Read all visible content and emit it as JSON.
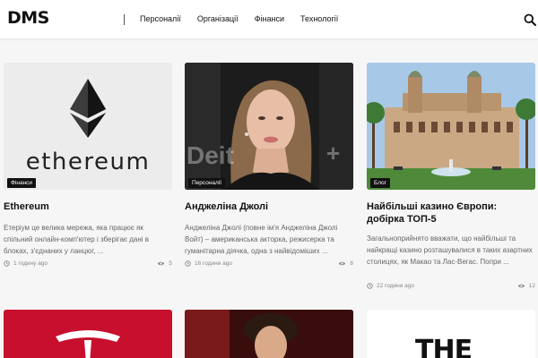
{
  "header": {
    "logo": "DMS",
    "nav": [
      "Персоналії",
      "Організації",
      "Фінанси",
      "Технології"
    ]
  },
  "cards": [
    {
      "badge": "Фінанси",
      "image_text": "ethereum",
      "title": "Ethereum",
      "excerpt": "Етеріум це велика мережа, яка працює як спільний онлайн-комп'ютер і зберігає дані в блоках, з'єднаних у ланцюг, ...",
      "time": "1 годину ago",
      "views": "5"
    },
    {
      "badge": "Персоналії",
      "image_text": "Deit",
      "title": "Анджеліна Джолі",
      "excerpt": "Анджеліна Джолі (повне ім'я Анджеліна Джолі Войт) – американська акторка, режисерка та гуманітарна діячка, одна з найвідоміших ...",
      "time": "16 години ago",
      "views": "8"
    },
    {
      "badge": "Блог",
      "image_text": "",
      "title": "Найбільші казино Європи: добірка ТОП-5",
      "excerpt": "Загальноприйнято вважати, що найбільші та найкращі казино розташувалися в таких азартних столицях, як Макао та Лас-Вегас. Попри ...",
      "time": "22 години ago",
      "views": "12"
    }
  ],
  "bottom": {
    "right_text": "THE"
  },
  "colors": {
    "accent": "#111111",
    "tesla_red": "#c8102e"
  }
}
